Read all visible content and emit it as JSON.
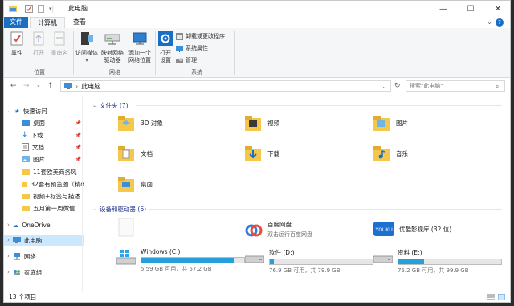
{
  "window": {
    "title": "此电脑"
  },
  "tabs": {
    "file": "文件",
    "computer": "计算机",
    "view": "查看"
  },
  "ribbon": {
    "location": {
      "properties": "属性",
      "open": "打开",
      "rename": "重命名",
      "group": "位置"
    },
    "network": {
      "access_media": "访问媒体",
      "map_drive_1": "映射网络",
      "map_drive_2": "驱动器",
      "add_location_1": "添加一个",
      "add_location_2": "网络位置",
      "group": "网络"
    },
    "system": {
      "open_settings_1": "打开",
      "open_settings_2": "设置",
      "uninstall": "卸载或更改程序",
      "sys_props": "系统属性",
      "manage": "管理",
      "group": "系统"
    }
  },
  "address": {
    "path": "此电脑",
    "search_placeholder": "搜索\"此电脑\""
  },
  "nav": {
    "quick_access": "快速访问",
    "pinned": [
      {
        "label": "桌面",
        "icon": "folder-blue-icon"
      },
      {
        "label": "下载",
        "icon": "download-icon"
      },
      {
        "label": "文档",
        "icon": "documents-icon"
      },
      {
        "label": "图片",
        "icon": "pictures-icon"
      }
    ],
    "recent": [
      "11套欧美商务风",
      "32套有预览图（精d",
      "视频+标签与描述",
      "五月第一周微信"
    ],
    "onedrive": "OneDrive",
    "this_pc": "此电脑",
    "network": "网络",
    "homegroup": "家庭组"
  },
  "folders_header": "文件夹 (7)",
  "folders": [
    "3D 对象",
    "视频",
    "图片",
    "文档",
    "下载",
    "音乐",
    "桌面"
  ],
  "devices_header": "设备和驱动器 (6)",
  "apps": [
    {
      "name": "百度网盘",
      "sub": "双击运行百度网盘"
    },
    {
      "name": "优酷影视库 (32 位)",
      "sub": ""
    }
  ],
  "drives": [
    {
      "name": "Windows (C:)",
      "space": "5.59 GB 可用，共 57.2 GB",
      "used": 0.9
    },
    {
      "name": "软件 (D:)",
      "space": "76.9 GB 可用，共 79.9 GB",
      "used": 0.04
    },
    {
      "name": "资料 (E:)",
      "space": "75.2 GB 可用，共 99.9 GB",
      "used": 0.25
    }
  ],
  "status": {
    "count": "13 个项目"
  },
  "colors": {
    "accent": "#1a6fc4",
    "selection": "#cce8ff",
    "drive_bar": "#26a0da"
  }
}
